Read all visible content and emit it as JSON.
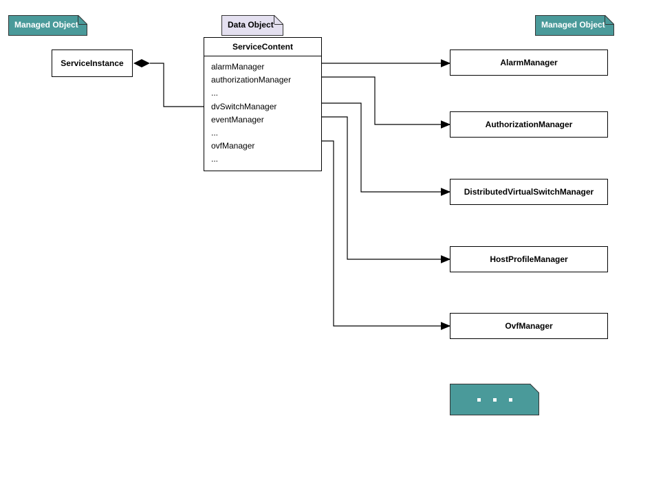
{
  "notes": {
    "managed_left": "Managed Object",
    "data_object": "Data Object",
    "managed_right": "Managed Object"
  },
  "service_instance": {
    "name": "ServiceInstance"
  },
  "service_content": {
    "name": "ServiceContent",
    "attrs": [
      "alarmManager",
      "authorizationManager",
      "...",
      "dvSwitchManager",
      "eventManager",
      "...",
      "ovfManager",
      "..."
    ]
  },
  "managers": [
    "AlarmManager",
    "AuthorizationManager",
    "DistributedVirtualSwitchManager",
    "HostProfileManager",
    "OvfManager"
  ]
}
